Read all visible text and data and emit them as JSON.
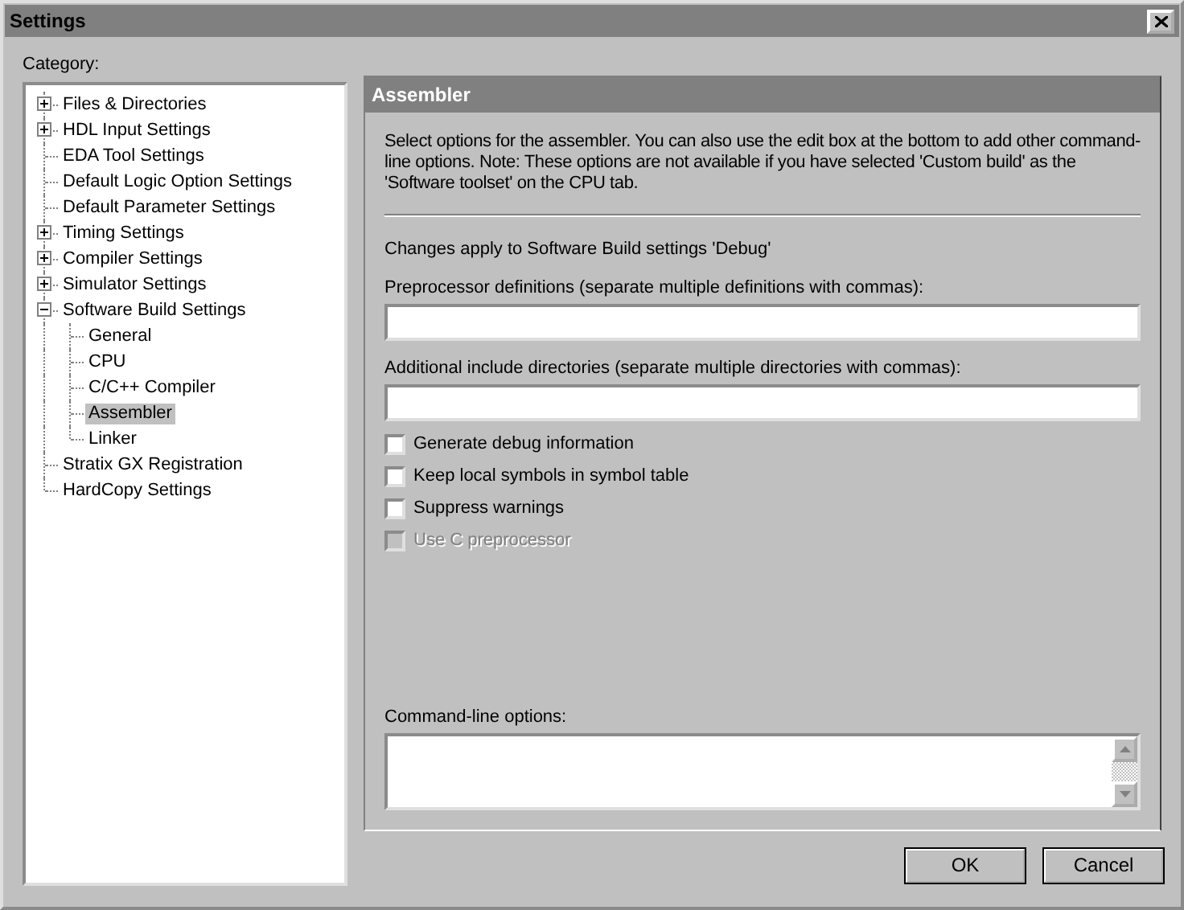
{
  "window": {
    "title": "Settings"
  },
  "category_label": "Category:",
  "tree": [
    {
      "label": "Files & Directories",
      "expanded": false,
      "selected": false
    },
    {
      "label": "HDL Input Settings",
      "expanded": false,
      "selected": false
    },
    {
      "label": "EDA Tool Settings",
      "selected": false
    },
    {
      "label": "Default Logic Option Settings",
      "selected": false
    },
    {
      "label": "Default Parameter Settings",
      "selected": false
    },
    {
      "label": "Timing Settings",
      "expanded": false,
      "selected": false
    },
    {
      "label": "Compiler Settings",
      "expanded": false,
      "selected": false
    },
    {
      "label": "Simulator Settings",
      "expanded": false,
      "selected": false
    },
    {
      "label": "Software Build Settings",
      "expanded": true,
      "selected": false,
      "children": [
        {
          "label": "General",
          "selected": false
        },
        {
          "label": "CPU",
          "selected": false
        },
        {
          "label": "C/C++ Compiler",
          "selected": false
        },
        {
          "label": "Assembler",
          "selected": true
        },
        {
          "label": "Linker",
          "selected": false
        }
      ]
    },
    {
      "label": "Stratix GX Registration",
      "selected": false
    },
    {
      "label": "HardCopy Settings",
      "selected": false
    }
  ],
  "panel": {
    "title": "Assembler",
    "description": "Select options for the assembler. You can also use the edit box at the bottom to add other command-line options. Note: These options are not available if you have selected 'Custom build' as the 'Software toolset' on the CPU tab.",
    "build_note": "Changes apply to Software Build settings 'Debug'",
    "fields": [
      {
        "label": "Preprocessor definitions (separate multiple definitions with commas):"
      },
      {
        "label": "Additional include directories (separate multiple directories with commas):"
      }
    ],
    "options": [
      {
        "label": "Generate debug information",
        "checked": false,
        "disabled": false
      },
      {
        "label": "Keep local symbols in symbol table",
        "checked": false,
        "disabled": false
      },
      {
        "label": "Suppress warnings",
        "checked": false,
        "disabled": false
      },
      {
        "label": "Use C preprocessor",
        "checked": false,
        "disabled": true
      }
    ],
    "command_line": {
      "label": "Command-line options:"
    }
  },
  "buttons": [
    {
      "label": "OK"
    },
    {
      "label": "Cancel"
    }
  ]
}
